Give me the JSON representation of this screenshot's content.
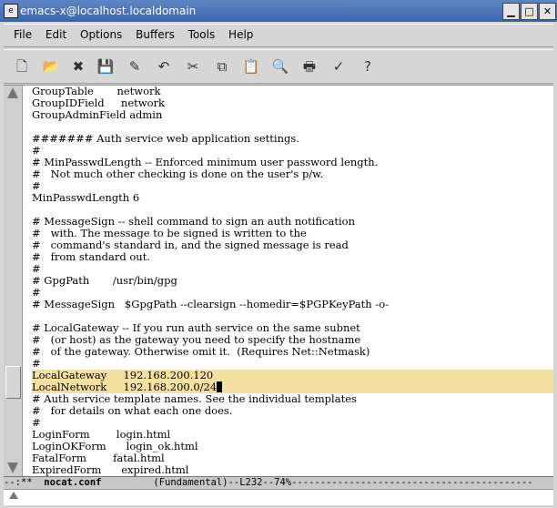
{
  "window": {
    "title": "emacs-x@localhost.localdomain",
    "buttons": {
      "minimize": "▁",
      "maximize": "□",
      "close": "✕"
    }
  },
  "menubar": {
    "items": [
      "File",
      "Edit",
      "Options",
      "Buffers",
      "Tools",
      "Help"
    ]
  },
  "toolbar": {
    "icons": [
      "new-file-icon",
      "open-folder-icon",
      "close-icon",
      "save-icon",
      "save-as-icon",
      "undo-icon",
      "cut-icon",
      "copy-icon",
      "paste-icon",
      "search-icon",
      "print-icon",
      "spell-check-icon",
      "help-icon"
    ]
  },
  "editor": {
    "lines": [
      "GroupTable       network",
      "GroupIDField     network",
      "GroupAdminField admin",
      "",
      "####### Auth service web application settings.",
      "#",
      "# MinPasswdLength -- Enforced minimum user password length.",
      "#   Not much other checking is done on the user's p/w.",
      "#",
      "MinPasswdLength 6",
      "",
      "# MessageSign -- shell command to sign an auth notification",
      "#   with. The message to be signed is written to the",
      "#   command's standard in, and the signed message is read",
      "#   from standard out.",
      "#",
      "# GpgPath       /usr/bin/gpg",
      "#",
      "# MessageSign   $GpgPath --clearsign --homedir=$PGPKeyPath -o-",
      "",
      "# LocalGateway -- If you run auth service on the same subnet",
      "#   (or host) as the gateway you need to specify the hostname",
      "#   of the gateway. Otherwise omit it.  (Requires Net::Netmask)",
      "#",
      "LocalGateway     192.168.200.120",
      "LocalNetwork     192.168.200.0/24",
      "# Auth service template names. See the individual templates",
      "#   for details on what each one does.",
      "#",
      "LoginForm        login.html",
      "LoginOKForm      login_ok.html",
      "FatalForm        fatal.html",
      "ExpiredForm      expired.html"
    ]
  },
  "modeline": {
    "prefix": "--:**  ",
    "buffer": "nocat.conf",
    "mode": "(Fundamental)",
    "position": "--L232--74%",
    "fill": "------------------------------------------"
  },
  "colors": {
    "highlight": "#f4e0a0",
    "titlebar": "#3b64ab"
  }
}
